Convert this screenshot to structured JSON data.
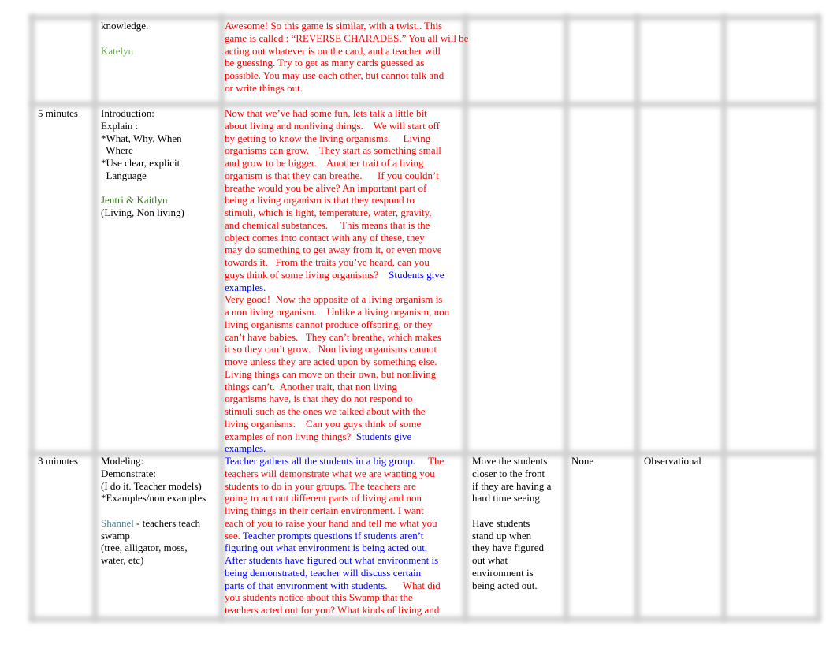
{
  "colors": {
    "k": "#000000",
    "r": "#ff0000",
    "b": "#0000ff",
    "g1": "#6aa84f",
    "g2": "#38761d",
    "t": "#45818e"
  },
  "rows": [
    {
      "cells": [
        [],
        [
          [
            [
              "k",
              "knowledge."
            ]
          ],
          [],
          [
            [
              "g1",
              "Katelyn"
            ]
          ]
        ],
        [
          [
            [
              "r",
              "Awesome! So this game is similar, with a twist.. This"
            ]
          ],
          [
            [
              "r",
              "game is called : “REVERSE CHARADES.” You all will be"
            ]
          ],
          [
            [
              "r",
              "acting out whatever is on the card, and a teacher will"
            ]
          ],
          [
            [
              "r",
              "be guessing. Try to get as many cards guessed as"
            ]
          ],
          [
            [
              "r",
              "possible. You may use each other, but cannot talk and"
            ]
          ],
          [
            [
              "r",
              "or write things out."
            ]
          ]
        ],
        [],
        [],
        [],
        []
      ]
    },
    {
      "cells": [
        [
          [
            [
              "k",
              "5 minutes"
            ]
          ]
        ],
        [
          [
            [
              "k",
              "Introduction:"
            ]
          ],
          [
            [
              "k",
              "Explain :"
            ]
          ],
          [
            [
              "k",
              "*What, Why, When"
            ]
          ],
          [
            [
              "k",
              "  Where"
            ]
          ],
          [
            [
              "k",
              "*Use clear, explicit"
            ]
          ],
          [
            [
              "k",
              "  Language"
            ]
          ],
          [],
          [
            [
              "g2",
              "Jentri & Kaitlyn"
            ]
          ],
          [
            [
              "k",
              "(Living, Non living)"
            ]
          ]
        ],
        [
          [
            [
              "r",
              "Now that we’ve had some fun, lets talk a little bit"
            ]
          ],
          [
            [
              "r",
              "about living and nonliving things.    We will start off"
            ]
          ],
          [
            [
              "r",
              "by getting to know the living organisms.     Living"
            ]
          ],
          [
            [
              "r",
              "organisms can grow.    They start as something small"
            ]
          ],
          [
            [
              "r",
              "and grow to be bigger.    Another trait of a living"
            ]
          ],
          [
            [
              "r",
              "organism is that they can breathe.      If you couldn’t"
            ]
          ],
          [
            [
              "r",
              "breathe would you be alive? An important part of"
            ]
          ],
          [
            [
              "r",
              "being a living organism is that they respond to"
            ]
          ],
          [
            [
              "r",
              "stimuli, which is light, temperature, water, gravity,"
            ]
          ],
          [
            [
              "r",
              "and chemical substances.     This means that is the"
            ]
          ],
          [
            [
              "r",
              "object comes into contact with any of these, they"
            ]
          ],
          [
            [
              "r",
              "may do something to get away from it, or even move"
            ]
          ],
          [
            [
              "r",
              "towards it.   From the traits you’ve heard, can you"
            ]
          ],
          [
            [
              "r",
              "guys think of some living organisms?    "
            ],
            [
              "b",
              "Students give"
            ]
          ],
          [
            [
              "b",
              "examples."
            ]
          ],
          [
            [
              "r",
              "Very good!  Now the opposite of a living organism is"
            ]
          ],
          [
            [
              "r",
              "a non living organism.    Unlike a living organism, non"
            ]
          ],
          [
            [
              "r",
              "living organisms cannot produce offspring, or they"
            ]
          ],
          [
            [
              "r",
              "can’t have babies.   They can’t breathe, which makes"
            ]
          ],
          [
            [
              "r",
              "it so they can’t grow.   Non living organisms cannot"
            ]
          ],
          [
            [
              "r",
              "move unless they are acted upon by something else."
            ]
          ],
          [
            [
              "r",
              "Living things can move on their own, but nonliving"
            ]
          ],
          [
            [
              "r",
              "things can’t.  Another trait, that non living"
            ]
          ],
          [
            [
              "r",
              "organisms have, is that they do not respond to"
            ]
          ],
          [
            [
              "r",
              "stimuli such as the ones we talked about with the"
            ]
          ],
          [
            [
              "r",
              "living organisms.    Can you guys think of some"
            ]
          ],
          [
            [
              "r",
              "examples of non living things?  "
            ],
            [
              "b",
              "Students give"
            ]
          ],
          [
            [
              "b",
              "examples."
            ]
          ]
        ],
        [],
        [],
        [],
        []
      ]
    },
    {
      "cells": [
        [
          [
            [
              "k",
              "3 minutes"
            ]
          ]
        ],
        [
          [
            [
              "k",
              "Modeling:"
            ]
          ],
          [
            [
              "k",
              "Demonstrate:"
            ]
          ],
          [
            [
              "k",
              "(I do it. Teacher models)"
            ]
          ],
          [
            [
              "k",
              "*Examples/non examples"
            ]
          ],
          [],
          [
            [
              "t",
              "Shannel"
            ],
            [
              "k",
              " - teachers teach"
            ]
          ],
          [
            [
              "k",
              "swamp"
            ]
          ],
          [
            [
              "k",
              "(tree, alligator, moss,"
            ]
          ],
          [
            [
              "k",
              "water, etc)"
            ]
          ]
        ],
        [
          [
            [
              "b",
              "Teacher gathers all the students in a big group.     "
            ],
            [
              "r",
              "The"
            ]
          ],
          [
            [
              "r",
              "teachers will demonstrate what we are wanting you"
            ]
          ],
          [
            [
              "r",
              "students to do in your groups. The teachers are"
            ]
          ],
          [
            [
              "r",
              "going to act out different parts of living and non"
            ]
          ],
          [
            [
              "r",
              "living things in their certain environment. I want"
            ]
          ],
          [
            [
              "r",
              "each of you to raise your hand and tell me what you"
            ]
          ],
          [
            [
              "r",
              "see. "
            ],
            [
              "b",
              "Teacher prompts questions if students aren’t"
            ]
          ],
          [
            [
              "b",
              "figuring out what environment is being acted out."
            ]
          ],
          [
            [
              "b",
              "After students have figured out what environment is"
            ]
          ],
          [
            [
              "b",
              "being demonstrated, teacher will discuss certain"
            ]
          ],
          [
            [
              "b",
              "parts of that environment with students.      "
            ],
            [
              "r",
              "What did"
            ]
          ],
          [
            [
              "r",
              "you students notice about this Swamp that the"
            ]
          ],
          [
            [
              "r",
              "teachers acted out for you? What kinds of living and"
            ]
          ]
        ],
        [
          [
            [
              "k",
              "Move the students"
            ]
          ],
          [
            [
              "k",
              "closer to the front"
            ]
          ],
          [
            [
              "k",
              "if they are having a"
            ]
          ],
          [
            [
              "k",
              "hard time seeing."
            ]
          ],
          [],
          [
            [
              "k",
              "Have students"
            ]
          ],
          [
            [
              "k",
              "stand up when"
            ]
          ],
          [
            [
              "k",
              "they have figured"
            ]
          ],
          [
            [
              "k",
              "out what"
            ]
          ],
          [
            [
              "k",
              "environment is"
            ]
          ],
          [
            [
              "k",
              "being acted out."
            ]
          ]
        ],
        [
          [
            [
              "k",
              "None"
            ]
          ]
        ],
        [
          [
            [
              "k",
              "Observational"
            ]
          ]
        ],
        []
      ]
    }
  ]
}
